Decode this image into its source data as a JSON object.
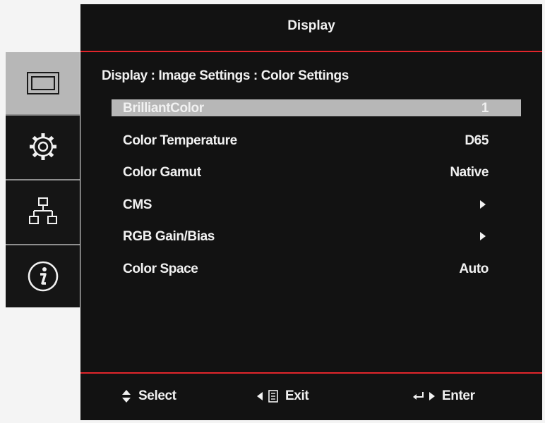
{
  "window": {
    "title": "Display"
  },
  "breadcrumb": "Display : Image Settings : Color Settings",
  "menu": [
    {
      "label": "BrilliantColor",
      "value": "1",
      "selected": true
    },
    {
      "label": "Color Temperature",
      "value": "D65"
    },
    {
      "label": "Color Gamut",
      "value": "Native"
    },
    {
      "label": "CMS",
      "icon": "right-arrow-icon"
    },
    {
      "label": "RGB Gain/Bias",
      "icon": "right-arrow-icon"
    },
    {
      "label": "Color Space",
      "value": "Auto"
    }
  ],
  "sidebar": {
    "items": [
      {
        "icon": "display-icon",
        "active": true
      },
      {
        "icon": "gear-icon"
      },
      {
        "icon": "network-icon"
      },
      {
        "icon": "info-icon"
      }
    ]
  },
  "footer": {
    "select": "Select",
    "exit": "Exit",
    "enter": "Enter"
  },
  "colors": {
    "osd_background": "#121212",
    "accent": "#e1252b",
    "highlight": "#b7b7b7",
    "text": "#f1f1f1"
  }
}
